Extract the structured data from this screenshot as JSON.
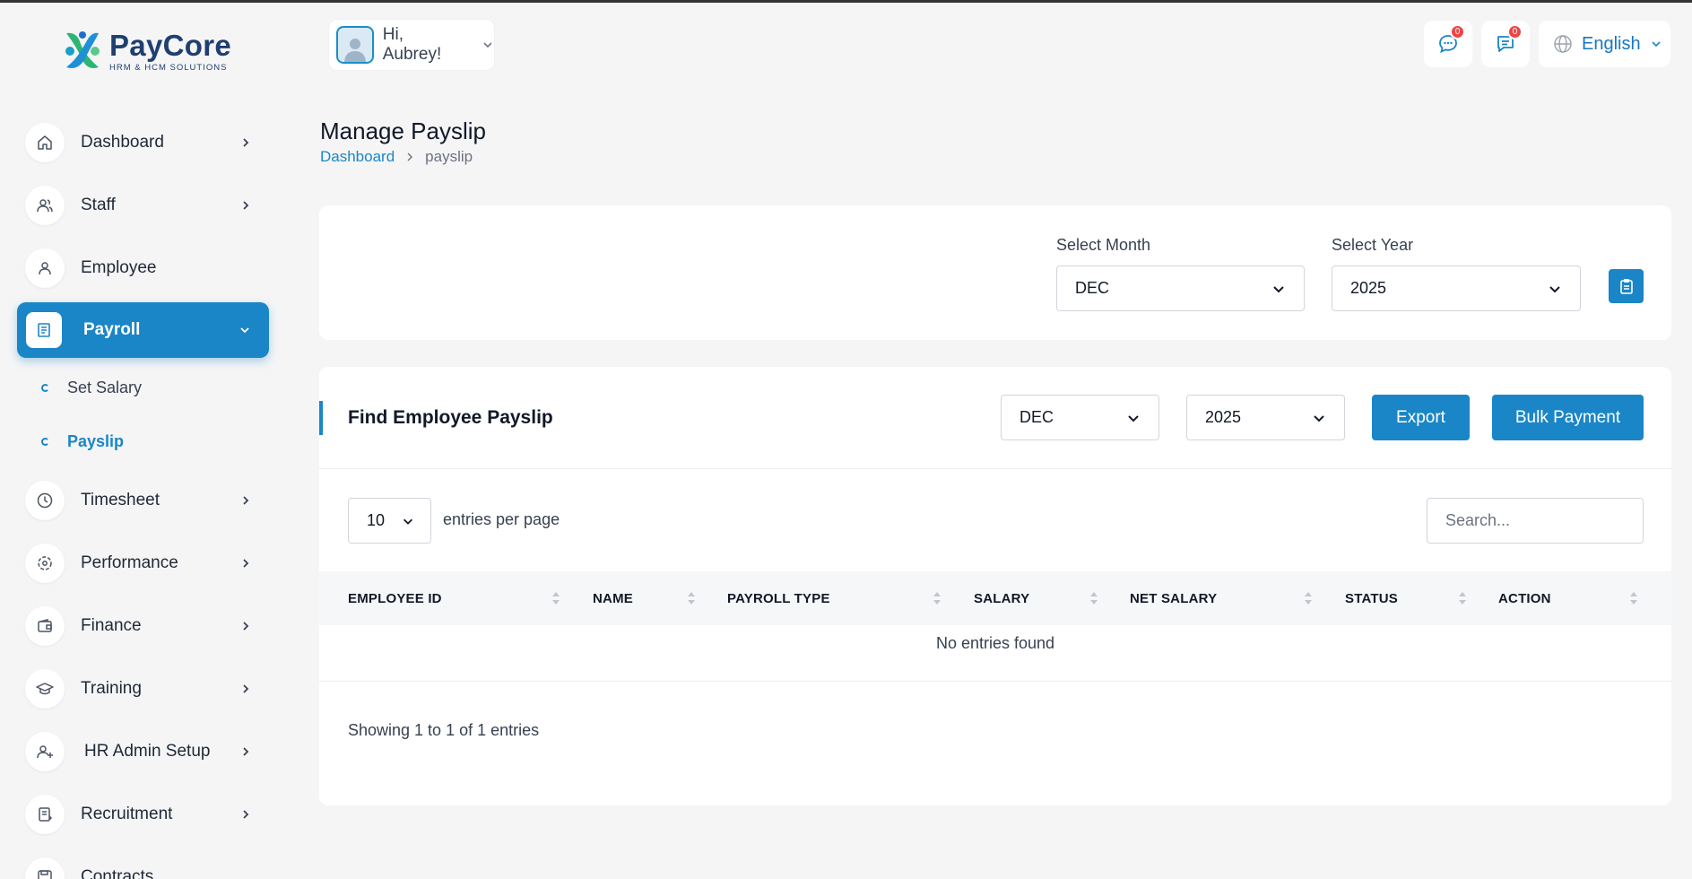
{
  "brand": {
    "name": "PayCore",
    "tagline": "HRM & HCM SOLUTIONS"
  },
  "user": {
    "greeting": "Hi, Aubrey!"
  },
  "topbar": {
    "messages_count": "0",
    "notifications_count": "0",
    "language": "English"
  },
  "sidebar": {
    "items": [
      {
        "label": "Dashboard"
      },
      {
        "label": "Staff"
      },
      {
        "label": "Employee"
      },
      {
        "label": "Payroll"
      },
      {
        "label": "Timesheet"
      },
      {
        "label": "Performance"
      },
      {
        "label": "Finance"
      },
      {
        "label": "Training"
      },
      {
        "label": "HR Admin Setup"
      },
      {
        "label": "Recruitment"
      },
      {
        "label": "Contracts"
      }
    ],
    "payroll_sub": [
      {
        "label": "Set Salary"
      },
      {
        "label": "Payslip"
      }
    ]
  },
  "page": {
    "title": "Manage Payslip",
    "breadcrumb": [
      "Dashboard",
      "payslip"
    ]
  },
  "filter": {
    "month_label": "Select Month",
    "month_value": "DEC",
    "year_label": "Select Year",
    "year_value": "2025"
  },
  "find": {
    "title": "Find Employee Payslip",
    "month_value": "DEC",
    "year_value": "2025",
    "export_label": "Export",
    "bulk_label": "Bulk Payment"
  },
  "table": {
    "per_page_value": "10",
    "per_page_label": "entries per page",
    "search_placeholder": "Search...",
    "columns": [
      "EMPLOYEE ID",
      "NAME",
      "PAYROLL TYPE",
      "SALARY",
      "NET SALARY",
      "STATUS",
      "ACTION"
    ],
    "empty_text": "No entries found",
    "showing_text": "Showing 1 to 1 of 1 entries"
  },
  "colors": {
    "accent": "#1a86c7",
    "badge": "#ef4444",
    "background": "#f5f5f6"
  }
}
